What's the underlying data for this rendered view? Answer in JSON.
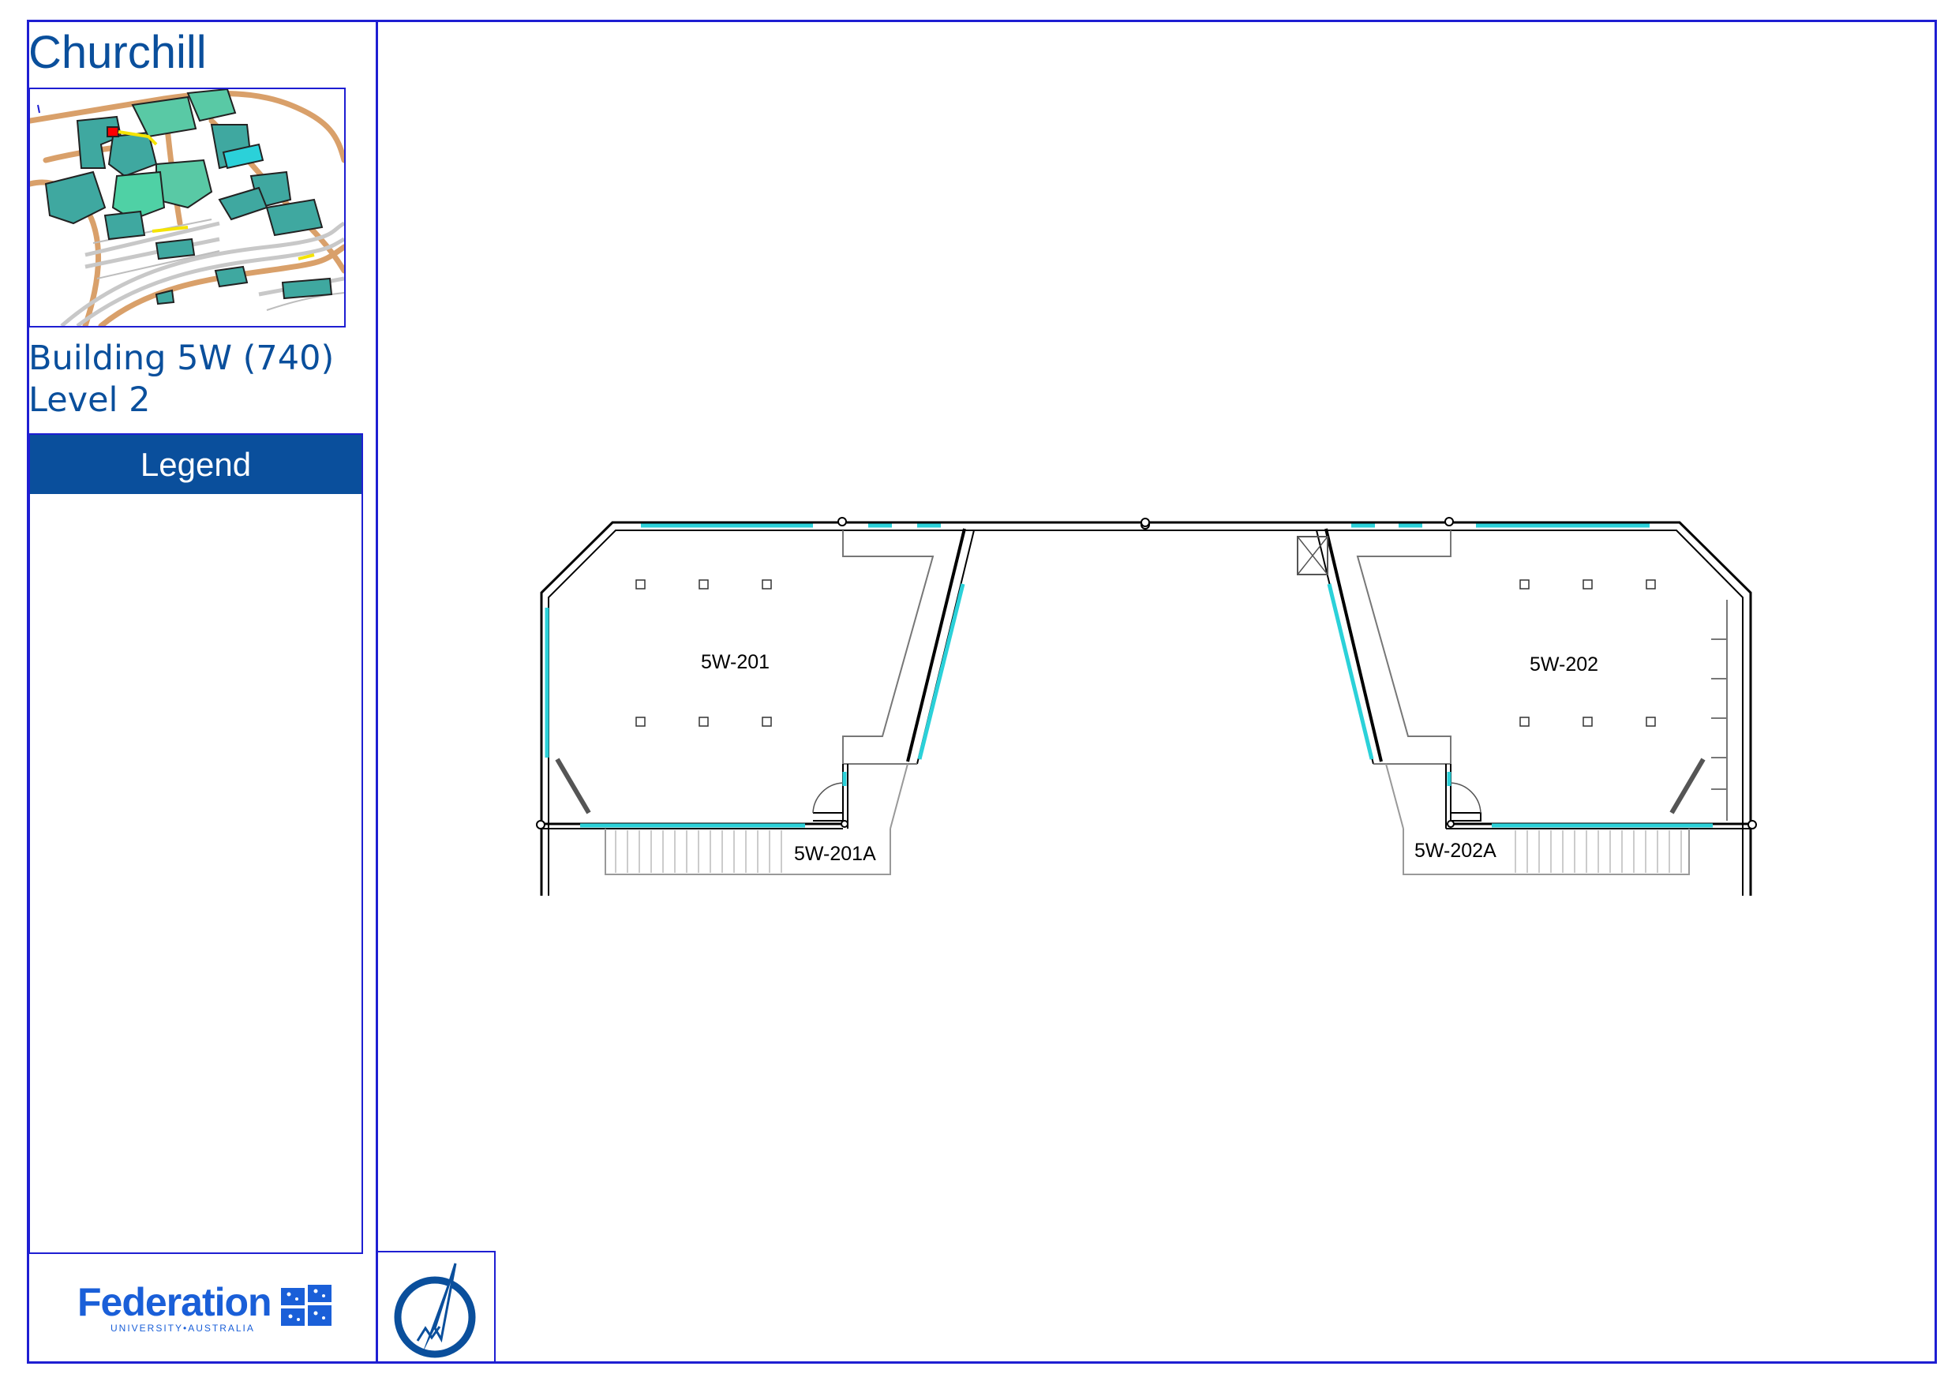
{
  "campus": "Churchill",
  "building": "Building 5W (740)",
  "level": "Level 2",
  "legend": {
    "title": "Legend"
  },
  "logo": {
    "name": "Federation",
    "subtitle": "UNIVERSITY•AUSTRALIA"
  },
  "rooms": [
    {
      "id": "5W-201"
    },
    {
      "id": "5W-201A"
    },
    {
      "id": "5W-202"
    },
    {
      "id": "5W-202A"
    }
  ],
  "colors": {
    "frame": "#1e1ed2",
    "brand_blue": "#0a4f9c",
    "logo_blue": "#1a5fd8",
    "glazing": "#2bd1d9",
    "minimap_building": "#3fa8a0",
    "minimap_road": "#d9a06a",
    "minimap_highlight": "#ff0000"
  },
  "icons": [
    "north-arrow-icon",
    "federation-flag-icon"
  ]
}
